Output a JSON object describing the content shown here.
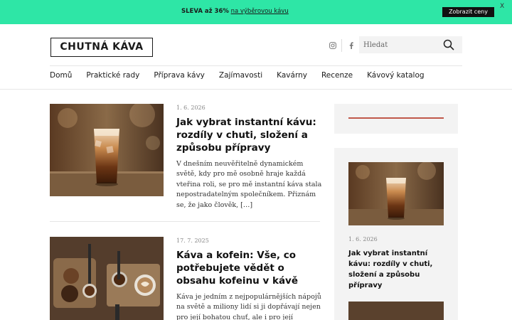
{
  "promo": {
    "bold": "SLEVA až 36%",
    "text": "na výběrovou kávu",
    "button": "Zobrazit ceny",
    "close": "X"
  },
  "header": {
    "logo": "CHUTNÁ KÁVA",
    "social": [
      "instagram-icon",
      "facebook-icon"
    ],
    "search_placeholder": "Hledat"
  },
  "nav": [
    "Domů",
    "Praktické rady",
    "Příprava kávy",
    "Zajímavosti",
    "Kavárny",
    "Recenze",
    "Kávový katalog"
  ],
  "articles": [
    {
      "date": "1. 6. 2026",
      "title": "Jak vybrat instantní kávu: rozdíly v chuti, složení a způsobu přípravy",
      "excerpt": "V dnešním neuvěřitelně dynamickém světě, kdy pro mě osobně hraje každá vteřina roli, se pro mě instantní káva stala nepostradatelným společníkem. Přiznám se, že jako člověk, […]",
      "image": "iced-coffee-glass"
    },
    {
      "date": "17. 7. 2025",
      "title": "Káva a kofein: Vše, co potřebujete vědět o obsahu kofeinu v kávě",
      "excerpt": "Káva je jedním z nejpopulárnějších nápojů na světě a miliony lidí si ji dopřávají nejen pro její bohatou chuť, ale i pro její",
      "image": "coffee-beans-board"
    }
  ],
  "sidebar": {
    "featured": {
      "date": "1. 6. 2026",
      "title": "Jak vybrat instantní kávu: rozdíly v chuti, složení a způsobu přípravy"
    }
  },
  "colors": {
    "promo_bg": "#2ee6a6",
    "accent_line": "#c0584a",
    "sidebar_bg": "#f3f3f3"
  }
}
